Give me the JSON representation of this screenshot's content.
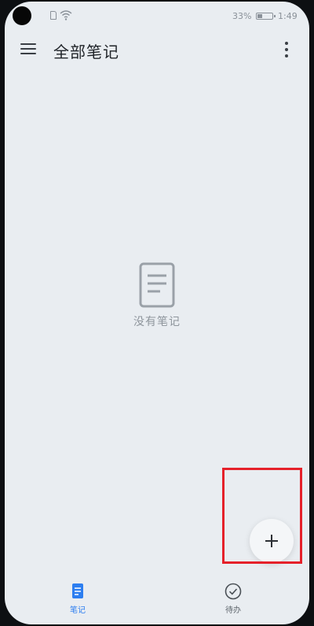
{
  "status_bar": {
    "battery_percent": "33%",
    "battery_level": 0.33,
    "time": "1:49"
  },
  "app_bar": {
    "title": "全部笔记"
  },
  "empty_state": {
    "message": "没有笔记"
  },
  "bottom_nav": {
    "items": [
      {
        "label": "笔记",
        "icon": "note-icon",
        "active": true
      },
      {
        "label": "待办",
        "icon": "check-circle-icon",
        "active": false
      }
    ]
  },
  "colors": {
    "background": "#e9edf1",
    "accent": "#2d7ef0",
    "highlight": "#e5212a"
  },
  "fab": {
    "icon": "plus-icon"
  }
}
